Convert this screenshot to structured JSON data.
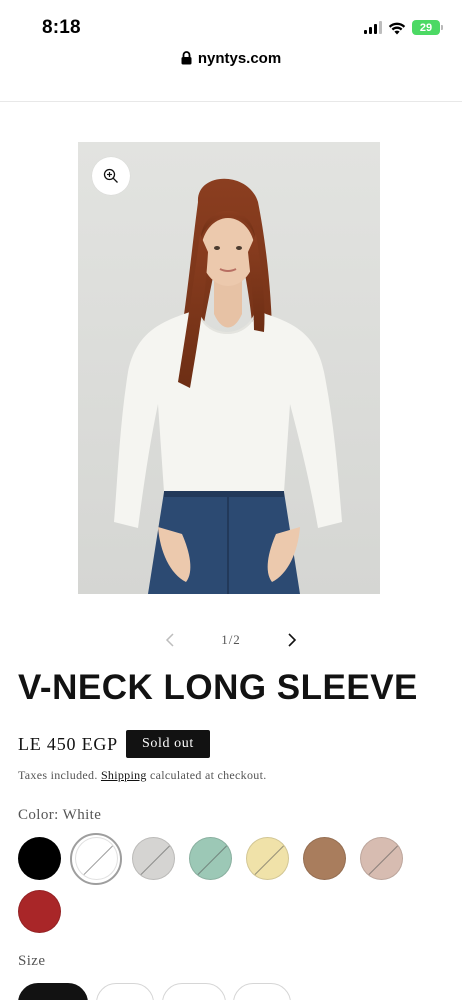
{
  "status_bar": {
    "time": "8:18",
    "battery": "29"
  },
  "browser": {
    "url": "nyntys.com"
  },
  "gallery": {
    "counter": "1/2",
    "image_alt": "Model wearing white v-neck long sleeve top"
  },
  "product": {
    "title": "V-NECK LONG SLEEVE",
    "price": "LE 450 EGP",
    "sold_out_label": "Sold out",
    "tax_text_before": "Taxes included.",
    "shipping_link": "Shipping",
    "tax_text_after": "calculated at checkout."
  },
  "color": {
    "label": "Color:",
    "selected": "White",
    "swatches": [
      {
        "name": "Black",
        "hex": "#000000"
      },
      {
        "name": "White",
        "hex": "#ffffff"
      },
      {
        "name": "Light Grey",
        "hex": "#d5d4d2"
      },
      {
        "name": "Mint",
        "hex": "#9cc8b6"
      },
      {
        "name": "Butter",
        "hex": "#f0e2a9"
      },
      {
        "name": "Brown",
        "hex": "#a97d5d"
      },
      {
        "name": "Blush",
        "hex": "#d7bcb1"
      },
      {
        "name": "Red",
        "hex": "#a92628"
      }
    ]
  },
  "size": {
    "label": "Size"
  },
  "colors": {
    "text": "#121212",
    "muted": "#555555",
    "badge": "#121212"
  }
}
